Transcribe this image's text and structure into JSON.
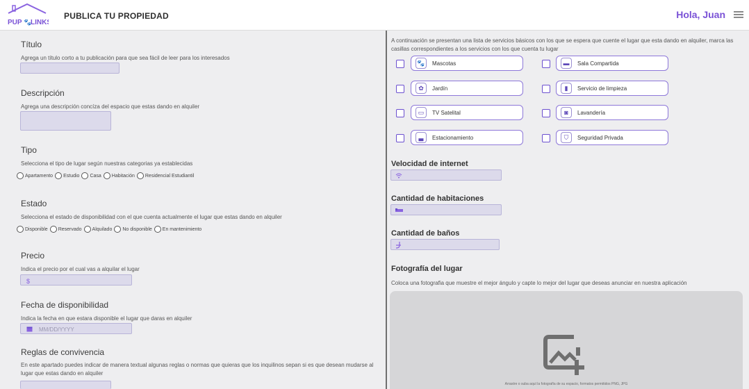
{
  "header": {
    "logo_text": "PUP LINKS",
    "title": "PUBLICA TU PROPIEDAD",
    "greeting": "Hola, Juan"
  },
  "left": {
    "titulo": {
      "title": "Título",
      "desc": "Agrega un título corto a tu publicación para que sea fácil de leer para los interesados"
    },
    "descripcion": {
      "title": "Descripción",
      "desc": "Agrega una descripción concíza del espacio que estas dando en alquiler"
    },
    "tipo": {
      "title": "Tipo",
      "desc": "Selecciona el tipo de lugar según nuestras categorias ya establecidas",
      "options": [
        "Apartamento",
        "Estudio",
        "Casa",
        "Habitación",
        "Residencial Estudiantil"
      ]
    },
    "estado": {
      "title": "Estado",
      "desc": "Selecciona el estado de disponibilidad con el que cuenta actualmente el lugar que estas dando en alquiler",
      "options": [
        "Disponible",
        "Reservado",
        "Alquilado",
        "No disponible",
        "En mantenimiento"
      ]
    },
    "precio": {
      "title": "Precio",
      "desc": "Indica el precio por el cual vas a alquilar el lugar",
      "icon": "$"
    },
    "fecha": {
      "title": "Fecha de disponibilidad",
      "desc": "Indica la fecha en que estara disponible el lugar que daras en alquiler",
      "placeholder": "MM/DD/YYYY"
    },
    "reglas": {
      "title": "Reglas de convivencia",
      "desc": "En este apartado puedes indicar de manera textual algunas reglas o normas que quieras que los inquilinos sepan si es que desean mudarse al lugar que estas dando en alquiler"
    }
  },
  "right": {
    "services_intro": "A continuación se presentan una lista de servicios básicos con los que se espera que cuente el lugar que esta dando en alquiler, marca las casillas correspondientes a los servicios con los que cuenta tu lugar",
    "services": [
      {
        "label": "Mascotas",
        "icon": "paw-icon"
      },
      {
        "label": "Sala Compartida",
        "icon": "sofa-icon"
      },
      {
        "label": "Jardín",
        "icon": "flower-icon"
      },
      {
        "label": "Servicio de limpieza",
        "icon": "spray-icon"
      },
      {
        "label": "TV Satelital",
        "icon": "tv-icon"
      },
      {
        "label": "Lavandería",
        "icon": "washer-icon"
      },
      {
        "label": "Estacionamiento",
        "icon": "car-icon"
      },
      {
        "label": "Seguridad Privada",
        "icon": "shield-icon"
      }
    ],
    "velocidad": {
      "title": "Velocidad de internet",
      "icon": "wifi-icon"
    },
    "habitaciones": {
      "title": "Cantidad de habitaciones",
      "icon": "bed-icon"
    },
    "banos": {
      "title": "Cantidad de baños",
      "icon": "toilet-icon"
    },
    "foto": {
      "title": "Fotografía del lugar",
      "desc": "Coloca una fotografia que muestre el mejor ángulo y capte lo mejor del lugar que deseas anunciar en nuestra aplicación",
      "hint": "Arrastre o suba aquí la fotografía de su espacio, formatos permitidos PNG, JPG"
    }
  },
  "colors": {
    "accent": "#7a52d6",
    "field_bg": "#dcdaeb",
    "divider": "#6f6f6f"
  }
}
